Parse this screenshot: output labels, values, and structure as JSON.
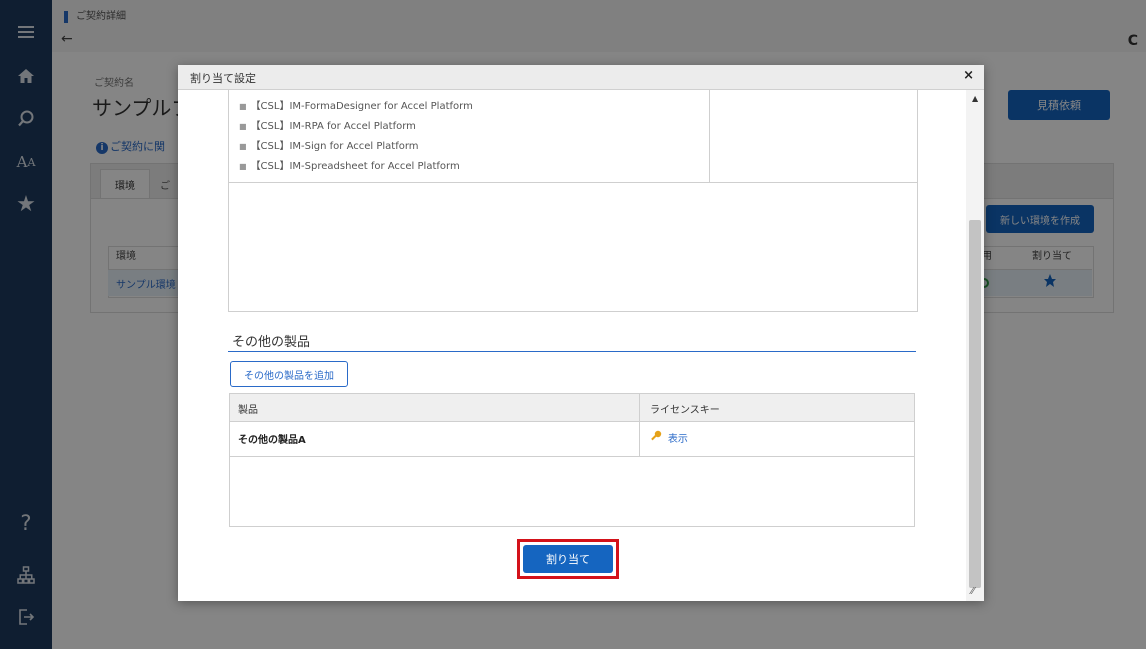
{
  "sidebar": {
    "items": [
      {
        "icon": "menu-icon"
      },
      {
        "icon": "home-icon"
      },
      {
        "icon": "search-icon"
      },
      {
        "icon": "font-size-icon",
        "label": "A"
      },
      {
        "icon": "star-icon",
        "label": "★"
      },
      {
        "icon": "help-icon",
        "label": "?"
      },
      {
        "icon": "sitemap-icon"
      },
      {
        "icon": "logout-icon"
      }
    ]
  },
  "header": {
    "page_title": "ご契約詳細",
    "back_glyph": "←",
    "reload_glyph": "C"
  },
  "background_page": {
    "contract_label": "ご契約名",
    "contract_name": "サンプルプ",
    "contract_info_icon": "i",
    "contract_info": "ご契約に関",
    "quote_button": "見積依頼",
    "tab_env": "環境",
    "tab_other": "ご",
    "new_env_button": "新しい環境を作成",
    "table_headers": {
      "env": "環境",
      "use": "用",
      "assign": "割り当て"
    },
    "table_row": {
      "env": "サンプル環境",
      "assign_icon": "⇟"
    }
  },
  "modal": {
    "title": "割り当て設定",
    "close_glyph": "×",
    "scroll_up_glyph": "▲",
    "resize_glyph": "⁄⁄",
    "products": [
      "【CSL】IM-FormaDesigner for Accel Platform",
      "【CSL】IM-RPA for Accel Platform",
      "【CSL】IM-Sign for Accel Platform",
      "【CSL】IM-Spreadsheet for Accel Platform"
    ],
    "other_products": {
      "title": "その他の製品",
      "add_button": "その他の製品を追加",
      "columns": [
        "製品",
        "ライセンスキー"
      ],
      "rows": [
        {
          "product": "その他の製品A",
          "license_key_link": "表示"
        }
      ]
    },
    "assign_button": "割り当て"
  },
  "colors": {
    "sidebar": "#1d3b5e",
    "primary": "#1565c0",
    "link": "#2a6ac8",
    "highlight": "#d3121a"
  }
}
